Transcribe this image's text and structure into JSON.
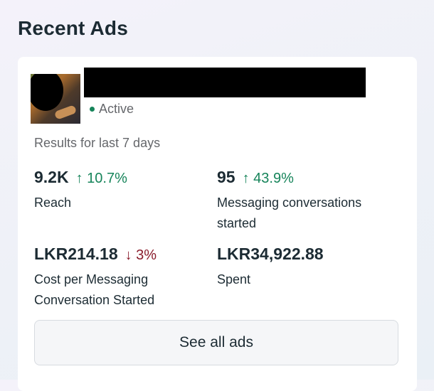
{
  "section": {
    "title": "Recent Ads"
  },
  "ad": {
    "status": "Active",
    "results_label": "Results for last 7 days",
    "metrics": [
      {
        "value": "9.2K",
        "change": "↑ 10.7%",
        "direction": "up",
        "label": "Reach"
      },
      {
        "value": "95",
        "change": "↑ 43.9%",
        "direction": "up",
        "label": "Messaging conversations started"
      },
      {
        "value": "LKR214.18",
        "change": "↓ 3%",
        "direction": "down",
        "label": "Cost per Messaging Conversation Started"
      },
      {
        "value": "LKR34,922.88",
        "change": "",
        "direction": "",
        "label": "Spent"
      }
    ],
    "see_all_label": "See all ads"
  },
  "colors": {
    "positive": "#16845a",
    "negative": "#8a1c2c",
    "status_active": "#16845a"
  }
}
